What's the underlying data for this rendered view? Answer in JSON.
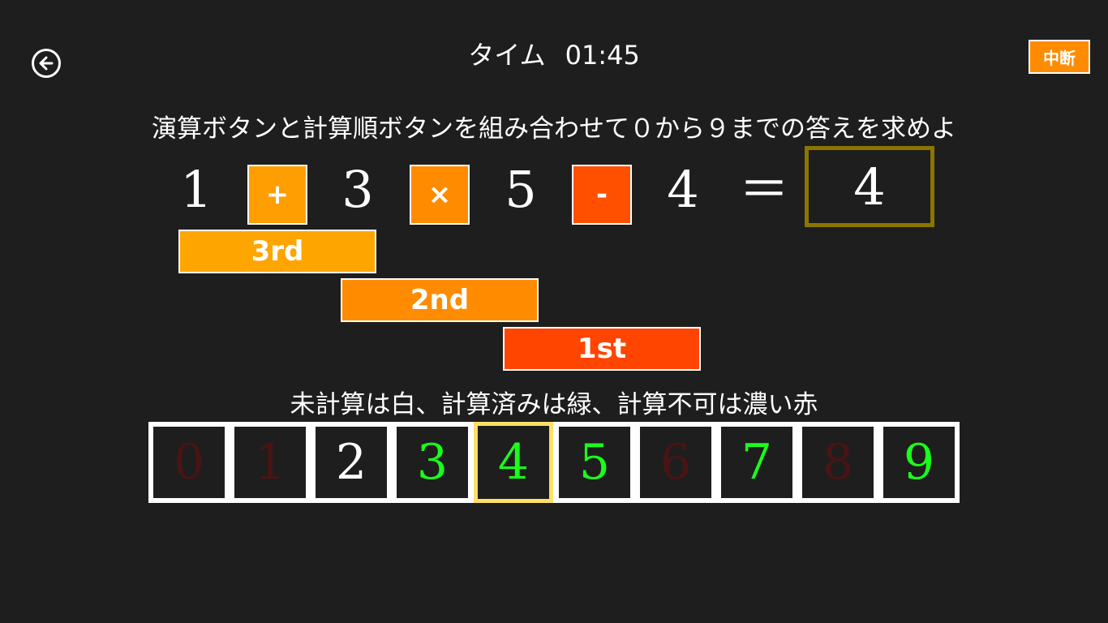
{
  "header": {
    "timer_label": "タイム",
    "timer_value": "01:45",
    "pause_label": "中断"
  },
  "instruction": "演算ボタンと計算順ボタンを組み合わせて０から９までの答えを求めよ",
  "equation": {
    "numbers": [
      "1",
      "3",
      "5",
      "4"
    ],
    "operators": [
      {
        "symbol": "+",
        "color": "#ff9e00"
      },
      {
        "symbol": "×",
        "color": "#ff8c00"
      },
      {
        "symbol": "-",
        "color": "#ff5000"
      }
    ],
    "equals": "＝",
    "answer": "4"
  },
  "order_buttons": [
    {
      "label": "3rd",
      "color": "#ffa500"
    },
    {
      "label": "2nd",
      "color": "#ff8c00"
    },
    {
      "label": "1st",
      "color": "#ff4500"
    }
  ],
  "legend": "未計算は白、計算済みは緑、計算不可は濃い赤",
  "digits": [
    {
      "value": "0",
      "state": "impossible",
      "color": "#4a1414"
    },
    {
      "value": "1",
      "state": "impossible",
      "color": "#4a1414"
    },
    {
      "value": "2",
      "state": "uncalculated",
      "color": "#ffffff"
    },
    {
      "value": "3",
      "state": "calculated",
      "color": "#1aff1a"
    },
    {
      "value": "4",
      "state": "calculated",
      "color": "#1aff1a"
    },
    {
      "value": "5",
      "state": "calculated",
      "color": "#1aff1a"
    },
    {
      "value": "6",
      "state": "impossible",
      "color": "#4a1414"
    },
    {
      "value": "7",
      "state": "calculated",
      "color": "#1aff1a"
    },
    {
      "value": "8",
      "state": "impossible",
      "color": "#4a1414"
    },
    {
      "value": "9",
      "state": "calculated",
      "color": "#1aff1a"
    }
  ],
  "selected_digit": "4",
  "colors": {
    "background": "#1e1e1e",
    "answer_border": "#8b7500",
    "selected_border": "#ffe066"
  }
}
